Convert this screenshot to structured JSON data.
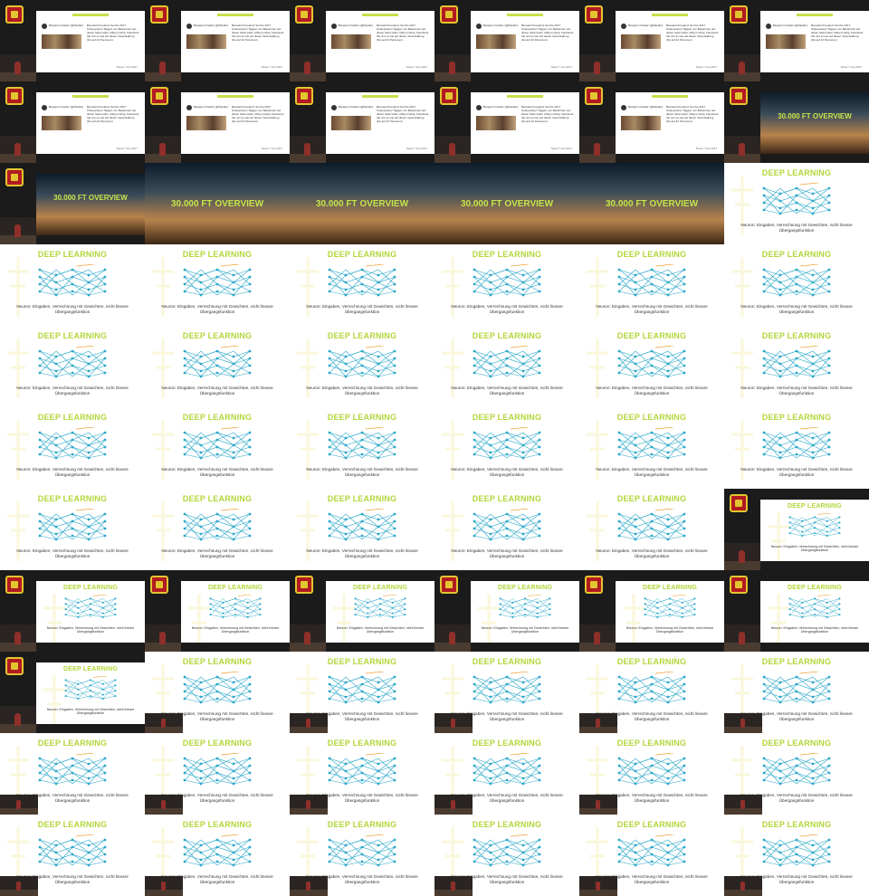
{
  "deep_learning": {
    "title": "DEEP LEARNING",
    "caption": "Neuron: Eingaben, Verrechnung mit Gewichten, nicht lineare Übergangsfunktion"
  },
  "overview": {
    "title": "30.000 FT OVERVIEW"
  },
  "tweet": {
    "author": "Benjamin Fiedler (@bfiedler)",
    "text": "Benward Froeland: Set the 2017 Ostseecamp! Taggen von Bekannten auf dieser Seite leider völlig unnötig. Facebook hat uns so wie auf dieser Veranstaltung (bis auf 42 Personen).",
    "footer": "Tweet 7 Jan 2017"
  },
  "thumbnails": [
    "tweet-stage",
    "tweet-stage",
    "tweet-stage",
    "tweet-stage",
    "tweet-stage",
    "tweet-stage",
    "tweet-stage",
    "tweet-stage",
    "tweet-stage",
    "tweet-stage",
    "tweet-stage",
    "overview-stage",
    "overview-stage",
    "overview-full",
    "overview-full",
    "overview-full",
    "overview-full",
    "dl-full",
    "dl-full",
    "dl-full",
    "dl-full",
    "dl-full",
    "dl-full",
    "dl-full",
    "dl-full",
    "dl-full",
    "dl-full",
    "dl-full",
    "dl-full",
    "dl-full",
    "dl-full",
    "dl-full",
    "dl-full",
    "dl-full",
    "dl-full",
    "dl-full",
    "dl-full",
    "dl-full",
    "dl-full",
    "dl-full",
    "dl-full",
    "dl-stage",
    "dl-stage",
    "dl-stage",
    "dl-stage",
    "dl-stage",
    "dl-stage",
    "dl-stage",
    "dl-stage",
    "dl-cam",
    "dl-cam",
    "dl-cam",
    "dl-cam",
    "dl-cam",
    "dl-cam",
    "dl-cam",
    "dl-cam",
    "dl-cam",
    "dl-cam",
    "dl-cam",
    "dl-cam",
    "dl-cam",
    "dl-cam",
    "dl-cam",
    "dl-cam",
    "dl-cam"
  ]
}
